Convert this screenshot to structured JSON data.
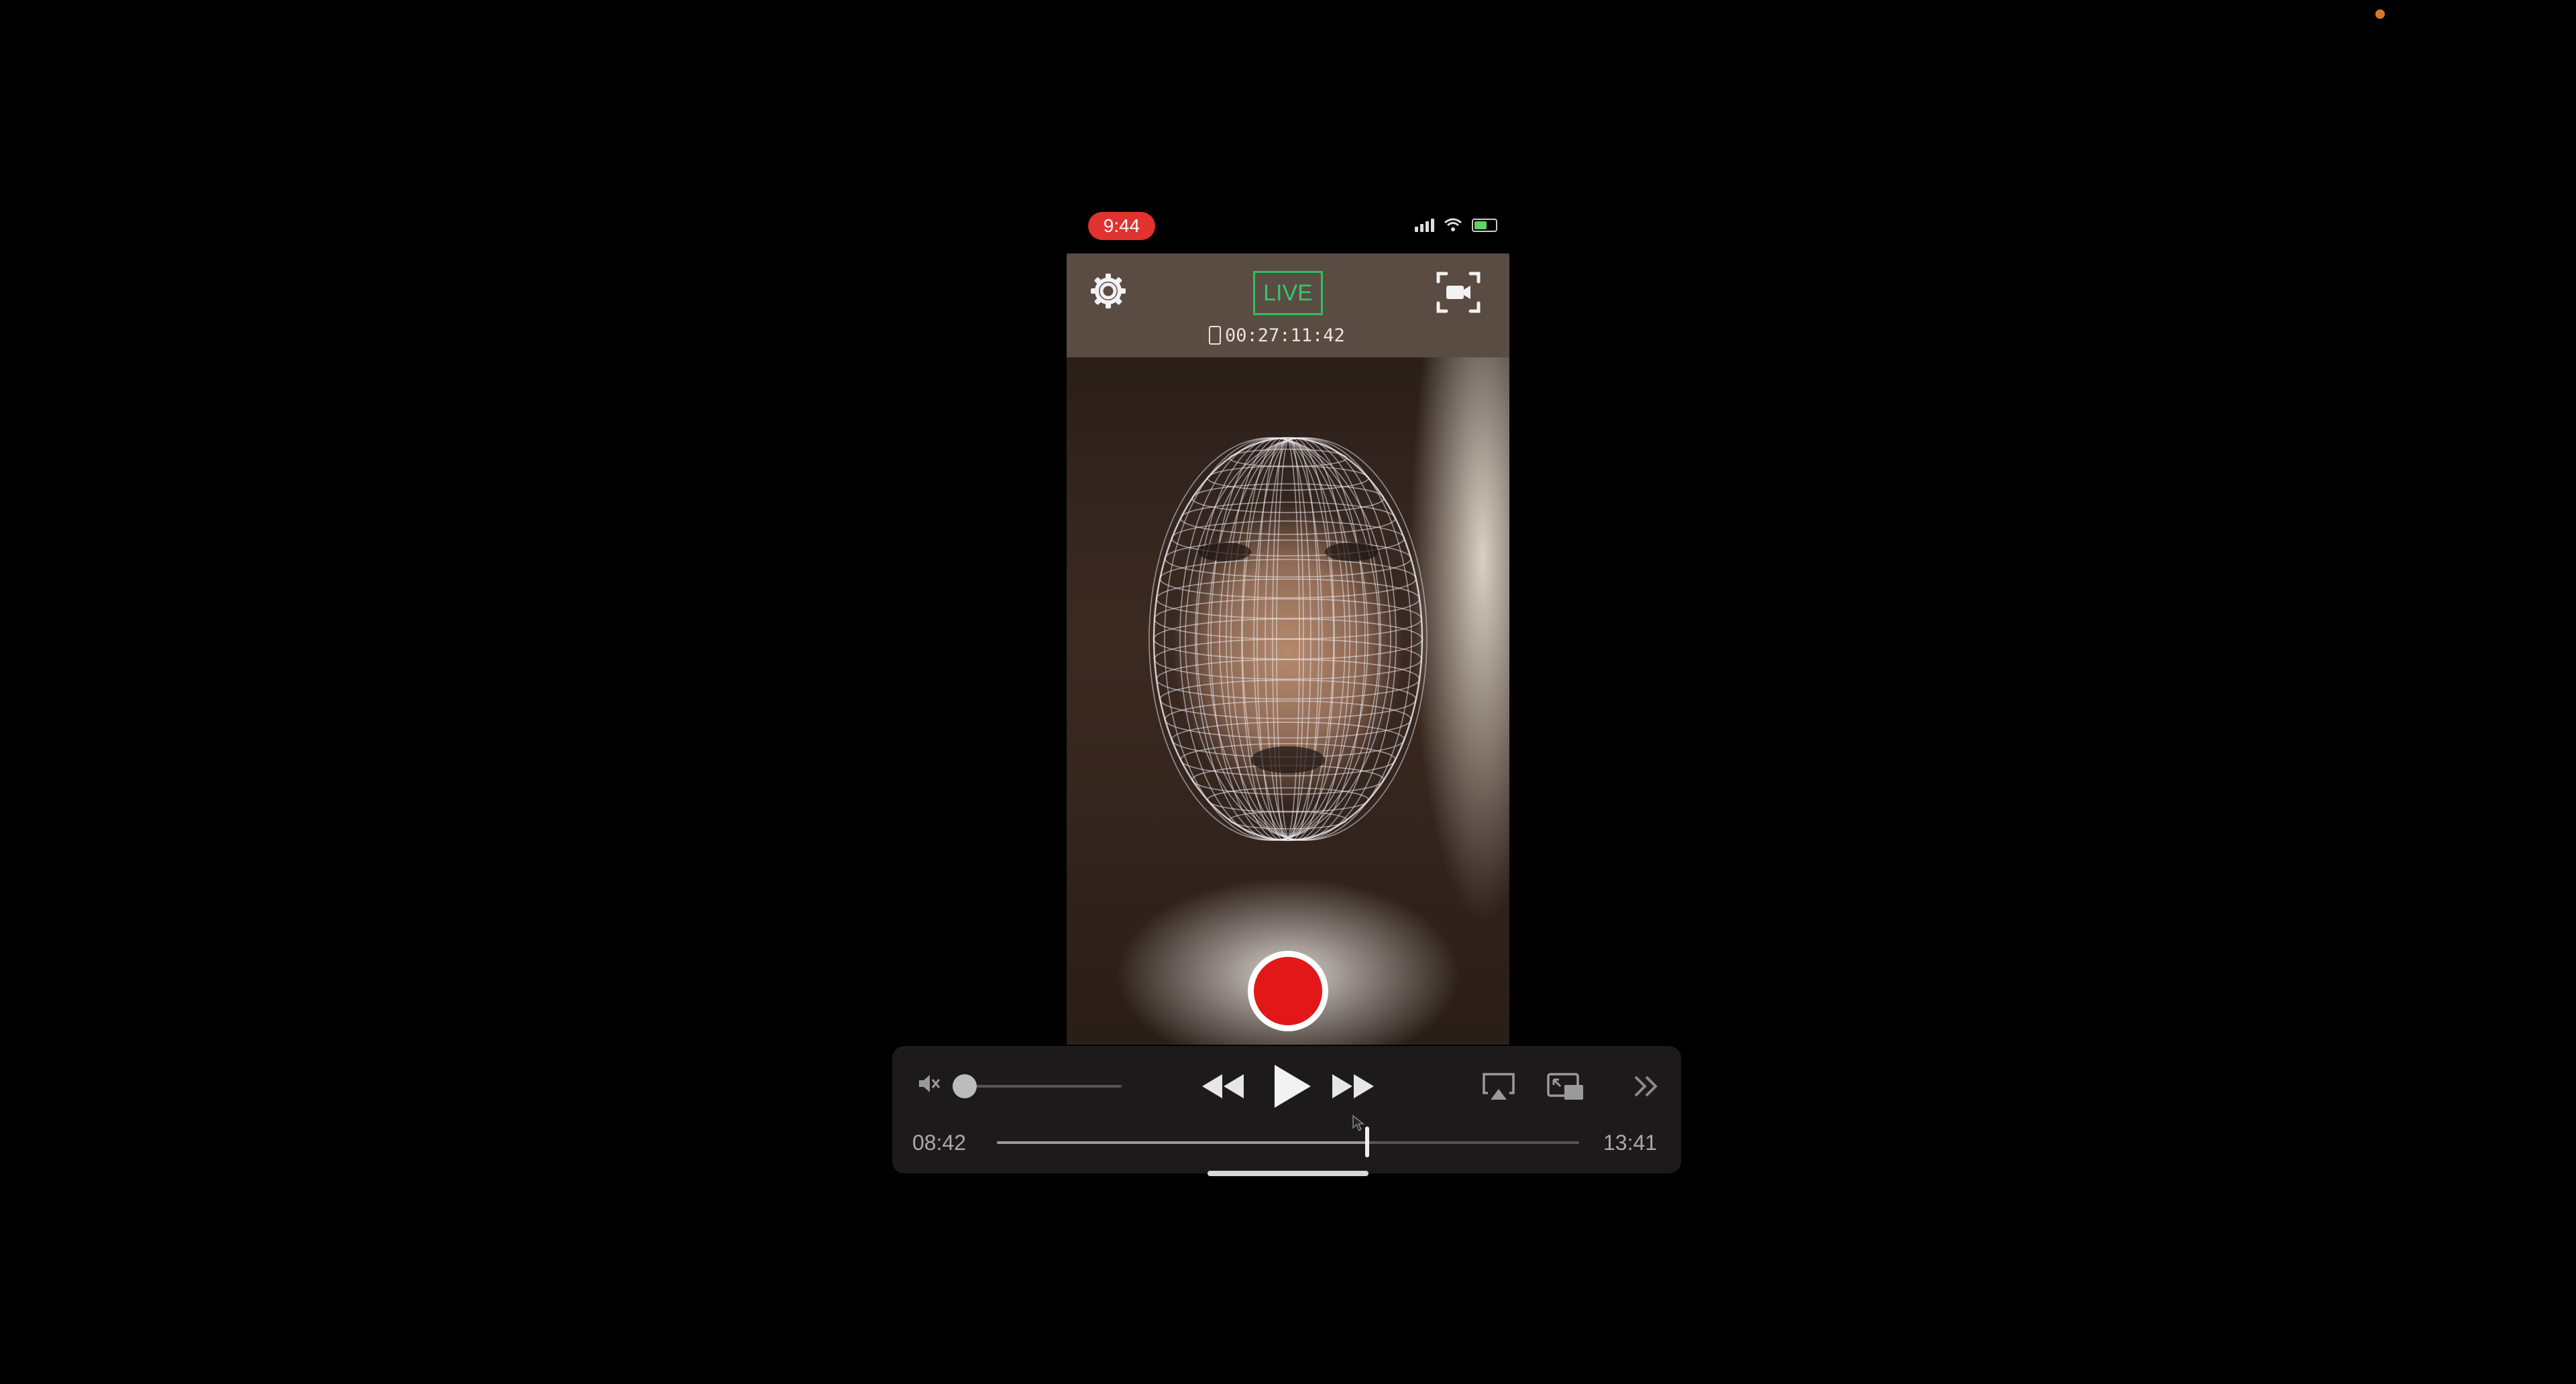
{
  "status_bar": {
    "time": "9:44"
  },
  "app": {
    "live_label": "LIVE",
    "timecode": "00:27:11:42",
    "icons": {
      "settings": "gear-icon",
      "camera_switch": "video-camera-frame-icon",
      "device": "phone-icon",
      "record": "record-icon"
    }
  },
  "media_controls": {
    "elapsed": "08:42",
    "total": "13:41",
    "progress_fraction": 0.636,
    "volume_fraction": 0.0,
    "muted": true,
    "icons": [
      "mute-icon",
      "rewind-icon",
      "play-icon",
      "fast-forward-icon",
      "airplay-icon",
      "picture-in-picture-icon",
      "more-chevron-icon"
    ]
  },
  "colors": {
    "live_green": "#2fbf5b",
    "record_red": "#e21818",
    "clock_pill_red": "#e0322e",
    "camera_indicator": "#d4782a"
  }
}
